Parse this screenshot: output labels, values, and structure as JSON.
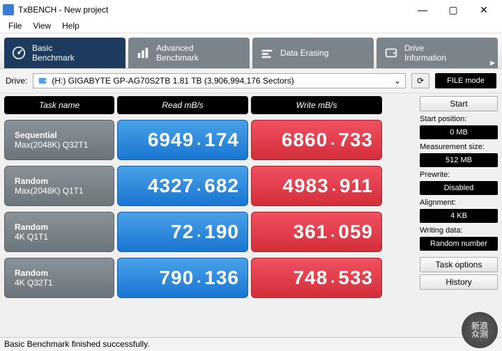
{
  "window": {
    "title": "TxBENCH - New project"
  },
  "menu": {
    "file": "File",
    "view": "View",
    "help": "Help"
  },
  "tabs": {
    "basic": {
      "l1": "Basic",
      "l2": "Benchmark"
    },
    "advanced": {
      "l1": "Advanced",
      "l2": "Benchmark"
    },
    "erase": {
      "l1": "Data Erasing",
      "l2": ""
    },
    "drive": {
      "l1": "Drive",
      "l2": "Information"
    }
  },
  "drive": {
    "label": "Drive:",
    "value": "(H:) GIGABYTE GP-AG70S2TB   1.81 TB (3,906,994,176 Sectors)",
    "fileMode": "FILE mode"
  },
  "headers": {
    "task": "Task name",
    "read": "Read mB/s",
    "write": "Write mB/s"
  },
  "rows": [
    {
      "name1": "Sequential",
      "name2": "Max(2048K) Q32T1",
      "readInt": "6949",
      "readDec": "174",
      "writeInt": "6860",
      "writeDec": "733"
    },
    {
      "name1": "Random",
      "name2": "Max(2048K) Q1T1",
      "readInt": "4327",
      "readDec": "682",
      "writeInt": "4983",
      "writeDec": "911"
    },
    {
      "name1": "Random",
      "name2": "4K Q1T1",
      "readInt": "72",
      "readDec": "190",
      "writeInt": "361",
      "writeDec": "059"
    },
    {
      "name1": "Random",
      "name2": "4K Q32T1",
      "readInt": "790",
      "readDec": "136",
      "writeInt": "748",
      "writeDec": "533"
    }
  ],
  "side": {
    "start": "Start",
    "startPosLabel": "Start position:",
    "startPosVal": "0 MB",
    "measLabel": "Measurement size:",
    "measVal": "512 MB",
    "prewriteLabel": "Prewrite:",
    "prewriteVal": "Disabled",
    "alignLabel": "Alignment:",
    "alignVal": "4 KB",
    "wdLabel": "Writing data:",
    "wdVal": "Random number",
    "taskOptions": "Task options",
    "history": "History"
  },
  "status": "Basic Benchmark finished successfully.",
  "watermark": {
    "l1": "新浪",
    "l2": "众测"
  }
}
